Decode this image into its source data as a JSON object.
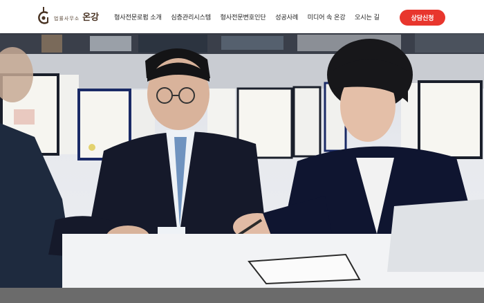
{
  "brand": {
    "subtitle": "법률사무소",
    "name": "온강"
  },
  "nav": {
    "items": [
      {
        "label": "형사전문로펌 소개"
      },
      {
        "label": "심층관리시스템"
      },
      {
        "label": "형사전문변호인단"
      },
      {
        "label": "성공사례"
      },
      {
        "label": "미디어 속 온강"
      },
      {
        "label": "오시는 길"
      }
    ]
  },
  "cta": {
    "label": "상담신청",
    "color": "#e8362d"
  },
  "hero": {
    "image_description_icon": "lawyers-meeting-photo"
  }
}
